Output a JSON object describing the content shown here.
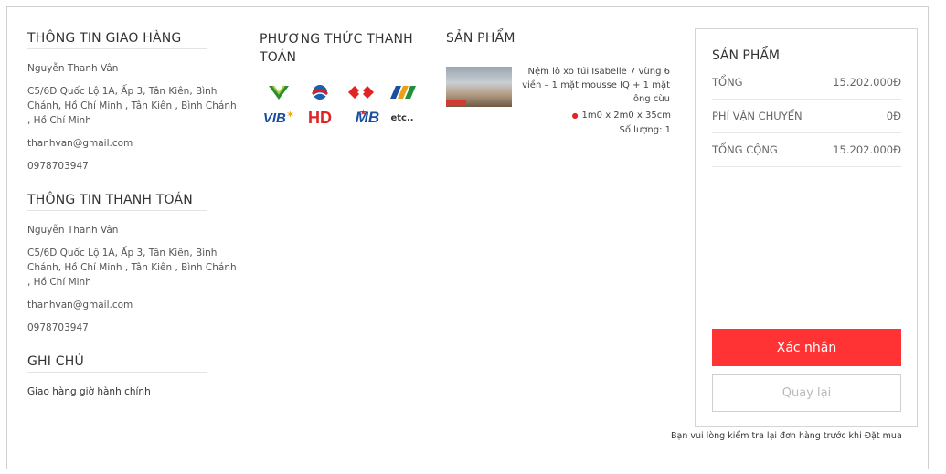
{
  "shipping": {
    "title": "THÔNG TIN GIAO HÀNG",
    "name": "Nguyễn Thanh Vân",
    "address": "C5/6D Quốc Lộ 1A, Ấp 3, Tân Kiên, Bình Chánh, Hồ Chí Minh , Tân Kiên , Bình Chánh , Hồ Chí Minh",
    "email": "thanhvan@gmail.com",
    "phone": "0978703947"
  },
  "payment_info": {
    "title": "THÔNG TIN THANH TOÁN",
    "name": "Nguyễn Thanh Vân",
    "address": "C5/6D Quốc Lộ 1A, Ấp 3, Tân Kiên, Bình Chánh, Hồ Chí Minh , Tân Kiên , Bình Chánh , Hồ Chí Minh",
    "email": "thanhvan@gmail.com",
    "phone": "0978703947"
  },
  "note": {
    "title": "GHI CHÚ",
    "text": "Giao hàng giờ hành chính"
  },
  "payment_method": {
    "title": "PHƯƠNG THỨC THANH TOÁN",
    "logos": {
      "vib": "VIB",
      "hd": "HD",
      "mb": "MB",
      "etc": "etc.."
    }
  },
  "product": {
    "title": "SẢN PHẨM",
    "name": "Nệm lò xo túi Isabelle 7 vùng 6 viền – 1 mặt mousse IQ + 1 mặt lông cừu",
    "size": "1m0 x 2m0 x 35cm",
    "quantity": "Số lượng: 1"
  },
  "summary": {
    "title": "SẢN PHẨM",
    "subtotal_label": "TỔNG",
    "subtotal_value": "15.202.000Đ",
    "shipping_label": "PHÍ VẬN CHUYỂN",
    "shipping_value": "0Đ",
    "total_label": "TỔNG CỘNG",
    "total_value": "15.202.000Đ",
    "confirm_label": "Xác nhận",
    "back_label": "Quay lại",
    "hint": "Bạn vui lòng kiểm tra lại đơn hàng trước khi Đặt mua"
  },
  "colors": {
    "accent": "#ff3333",
    "border": "#cfcfcf"
  }
}
